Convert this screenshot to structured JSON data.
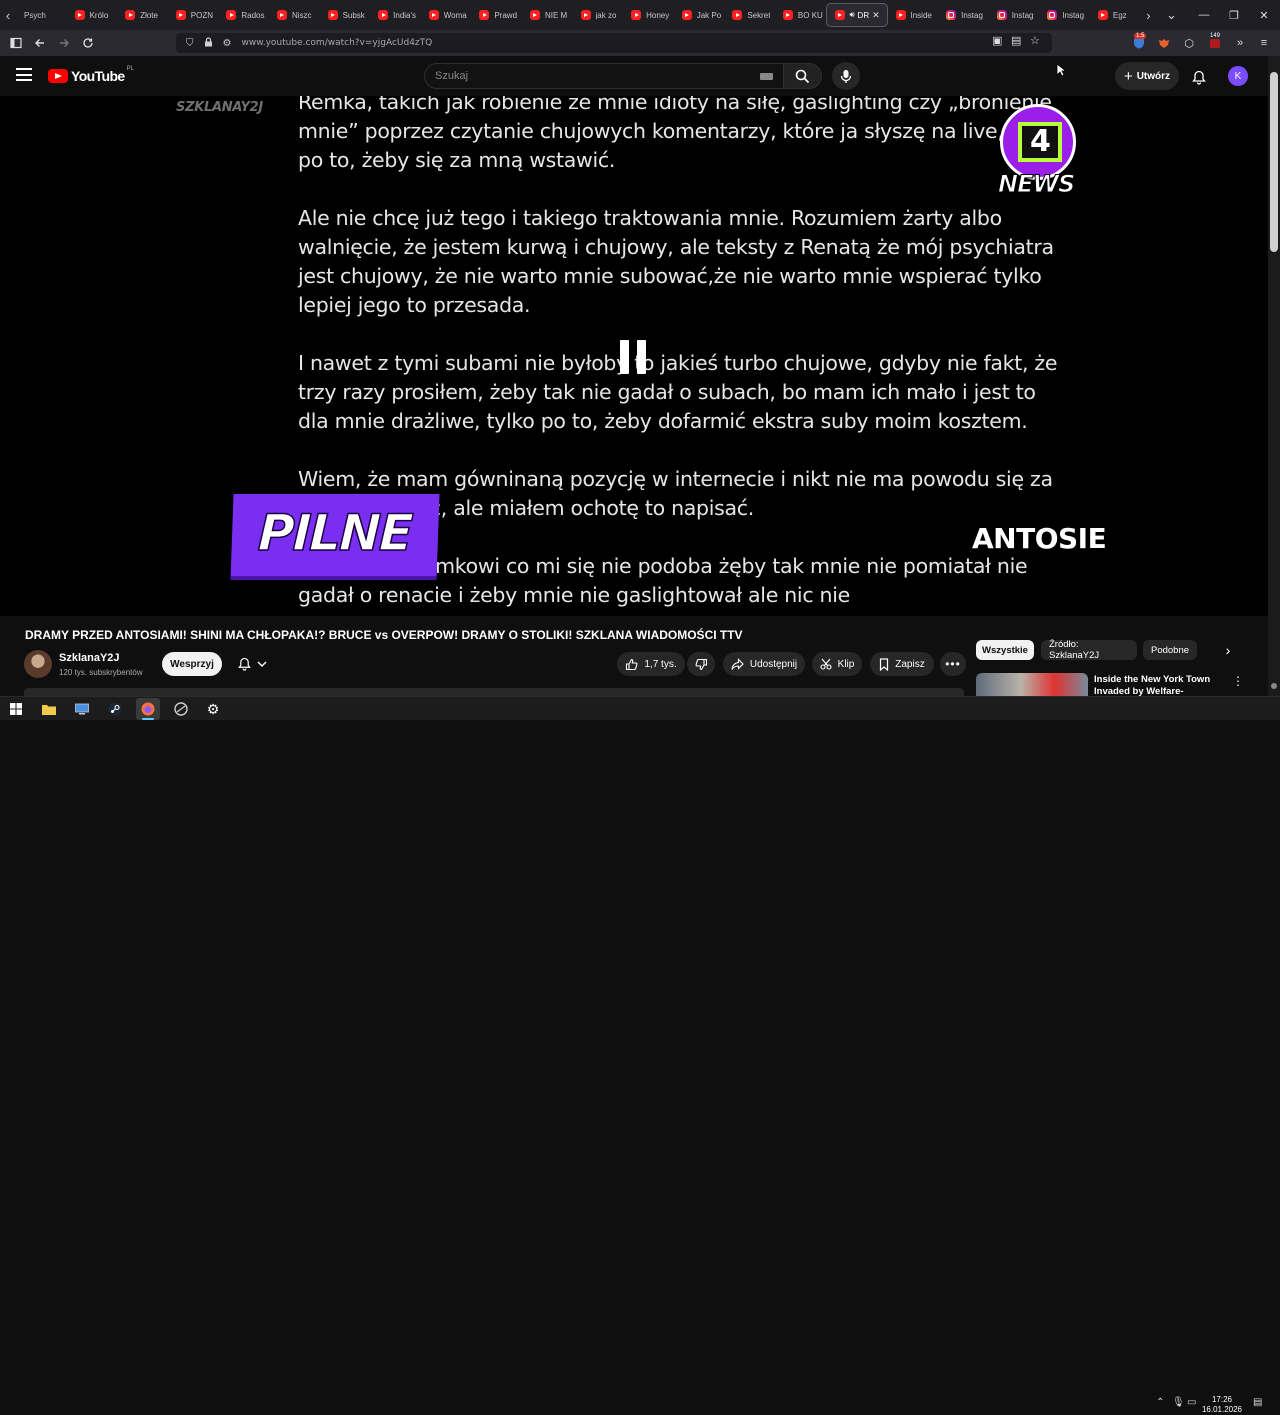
{
  "browser": {
    "tabs": [
      {
        "label": "Psych",
        "type": "plain"
      },
      {
        "label": "Królo",
        "type": "yt"
      },
      {
        "label": "Złote",
        "type": "yt"
      },
      {
        "label": "POZN",
        "type": "yt"
      },
      {
        "label": "Rados",
        "type": "yt"
      },
      {
        "label": "Niszc",
        "type": "yt"
      },
      {
        "label": "Subsk",
        "type": "yt"
      },
      {
        "label": "India's",
        "type": "yt"
      },
      {
        "label": "Woma",
        "type": "yt"
      },
      {
        "label": "Prawd",
        "type": "yt"
      },
      {
        "label": "NIE M",
        "type": "yt"
      },
      {
        "label": "jak zo",
        "type": "yt"
      },
      {
        "label": "Honey",
        "type": "yt"
      },
      {
        "label": "Jak Po",
        "type": "yt"
      },
      {
        "label": "Sekret",
        "type": "yt"
      },
      {
        "label": "BO KU",
        "type": "yt"
      },
      {
        "label": "DR",
        "type": "active"
      },
      {
        "label": "Inside",
        "type": "yt"
      },
      {
        "label": "Instag",
        "type": "insta"
      },
      {
        "label": "Instag",
        "type": "insta"
      },
      {
        "label": "Instag",
        "type": "insta"
      },
      {
        "label": "Egz",
        "type": "yt"
      }
    ],
    "url": "www.youtube.com/watch?v=yjgAcUd4zTQ",
    "ext_badge_1": "1.5",
    "ext_badge_2": "149"
  },
  "yt_header": {
    "logo_text": "YouTube",
    "logo_country": "PL",
    "search_placeholder": "Szukaj",
    "create_label": "Utwórz",
    "avatar_letter": "K"
  },
  "video": {
    "watermark": "SZKLANAY2J",
    "paragraphs": [
      "Remka, takich jak robienie ze mnie idioty na siłę, gaslighting czy „bronienie mnie” poprzez czytanie chujowych komentarzy, które ja słyszę na live, tylko po to, żeby się za mną wstawić.",
      "Ale nie chcę już tego i takiego traktowania mnie. Rozumiem żarty albo walnięcie, że jestem kurwą i chujowy, ale teksty z Renatą  że mój psychiatra jest chujowy, że nie warto mnie subować,że nie warto mnie wspierać tylko lepiej jego  to przesada.",
      "I nawet z tymi subami nie byłoby to jakieś turbo chujowe, gdyby nie fakt, że trzy razy prosiłem, żeby tak nie gadał o subach, bo mam ich mało i jest to dla mnie drażliwe, tylko po to, żeby dofarmić ekstra suby moim kosztem.",
      "Wiem, że mam gówninaną pozycję w internecie i nikt nie ma powodu się za mną wstawiać, ale miałem ochotę to napisać.",
      "Napisałem Remkowi co mi się nie podoba żęby tak mnie nie pomiatał nie gadał o renacie i żeby mnie nie gaslightował ale nic nie"
    ],
    "overlay_news": "NEWS",
    "overlay_pilne": "PILNE",
    "overlay_antosie": "ANTOSIE"
  },
  "watch": {
    "title": "DRAMY PRZED ANTOSIAMI! SHINI MA CHŁOPAKA!? BRUCE vs OVERPOW! DRAMY O STOLIKI! SZKLANA WIADOMOŚCI TTV",
    "channel_name": "SzklanaY2J",
    "subscribers": "120 tys. subskrybentów",
    "join_label": "Wesprzyj",
    "likes": "1,7 tys.",
    "share_label": "Udostępnij",
    "clip_label": "Klip",
    "save_label": "Zapisz"
  },
  "rail": {
    "chips": [
      "Wszystkie",
      "Źródło: SzklanaY2J",
      "Podobne"
    ],
    "rec_title": "Inside the New York Town Invaded by Welfare-Addicted"
  },
  "taskbar": {
    "time": "17:26",
    "date": "16.01.2026"
  }
}
